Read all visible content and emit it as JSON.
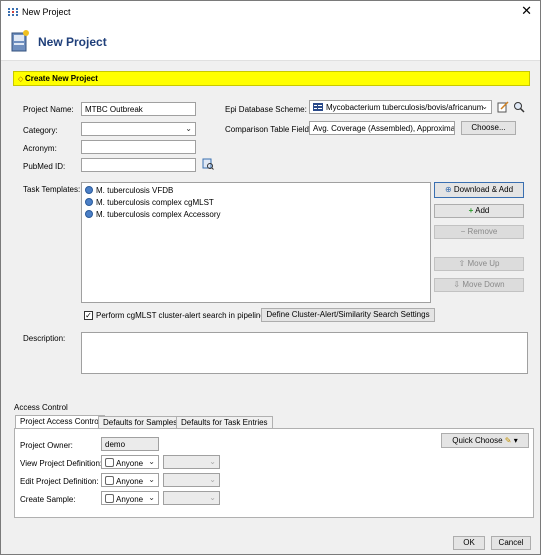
{
  "window": {
    "title": "New Project",
    "close_glyph": "✕"
  },
  "header": {
    "title": "New Project"
  },
  "banner": {
    "text": "Create New Project"
  },
  "form": {
    "project_name_label": "Project Name:",
    "project_name_value": "MTBC Outbreak",
    "category_label": "Category:",
    "category_value": "",
    "acronym_label": "Acronym:",
    "acronym_value": "",
    "pubmed_label": "PubMed ID:",
    "pubmed_value": "",
    "epi_label": "Epi Database Scheme:",
    "epi_value": "Mycobacterium tuberculosis/bovis/africanum",
    "comparison_label": "Comparison Table Fields:",
    "comparison_value": "Avg. Coverage (Assembled), Approximate",
    "choose_button": "Choose...",
    "task_templates_label": "Task Templates:",
    "task_templates": [
      "M. tuberculosis VFDB",
      "M. tuberculosis complex cgMLST",
      "M. tuberculosis complex Accessory"
    ],
    "download_add_button": "Download & Add",
    "add_button": "Add",
    "remove_button": "Remove",
    "move_up_button": "Move Up",
    "move_down_button": "Move Down",
    "cluster_alert_checkbox_label": "Perform cgMLST cluster-alert search in pipelines",
    "cluster_alert_checked": true,
    "define_cluster_button": "Define Cluster-Alert/Similarity Search Settings",
    "description_label": "Description:",
    "description_value": ""
  },
  "access": {
    "group_title": "Access Control",
    "tabs": [
      "Project Access Control",
      "Defaults for Samples",
      "Defaults for Task Entries"
    ],
    "quick_choose_button": "Quick Choose",
    "owner_label": "Project Owner:",
    "owner_value": "demo",
    "view_label": "View Project Definition:",
    "view_value": "Anyone",
    "edit_label": "Edit Project Definition:",
    "edit_value": "Anyone",
    "create_label": "Create Sample:",
    "create_value": "Anyone"
  },
  "footer": {
    "ok_button": "OK",
    "cancel_button": "Cancel"
  },
  "colors": {
    "banner": "#ffff00",
    "header_title": "#1f3f7a",
    "icon_blue": "#4b7fc6"
  }
}
